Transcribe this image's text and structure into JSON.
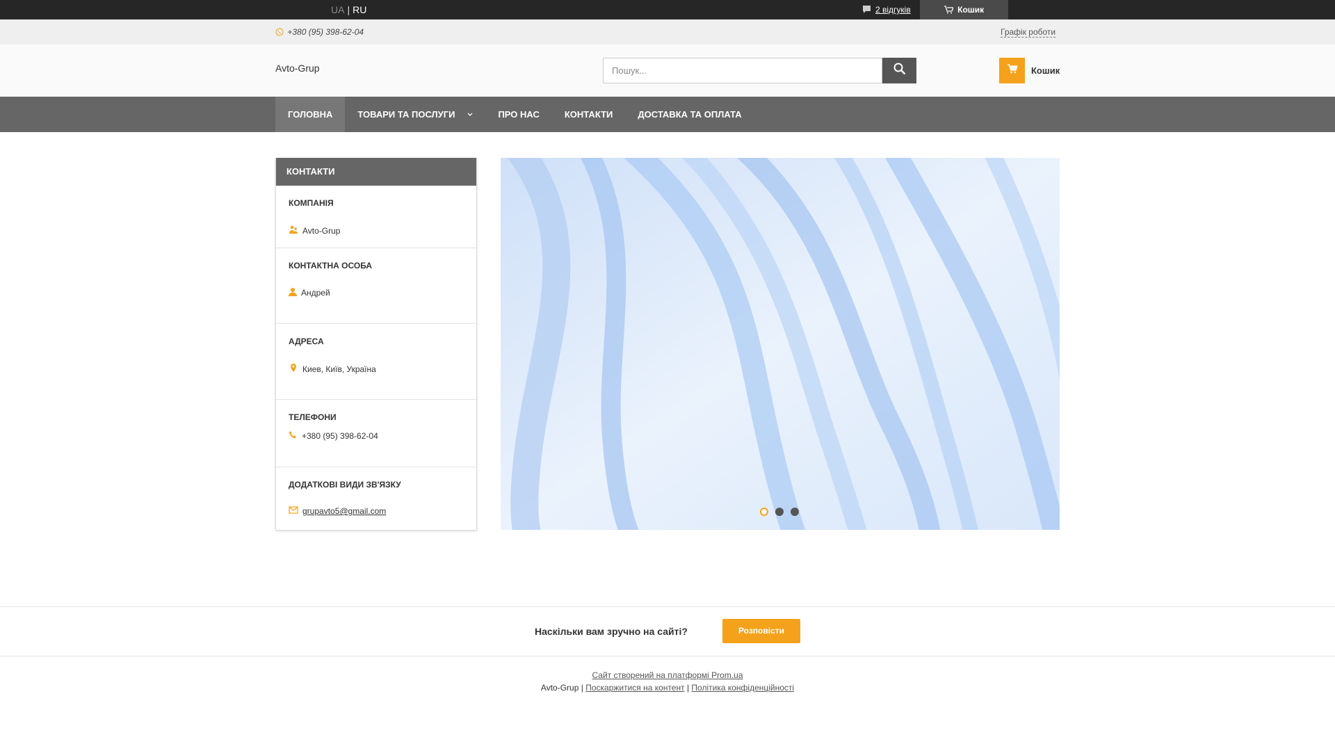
{
  "topbar": {
    "lang_ua": "UA",
    "lang_ru": "RU",
    "reviews": "2 відгуків",
    "cart": "Кошик"
  },
  "strip": {
    "phone": "+380 (95) 398-62-04",
    "schedule": "Графік роботи"
  },
  "header": {
    "logo": "Avto-Grup",
    "search_placeholder": "Пошук...",
    "cart_label": "Кошик"
  },
  "nav": {
    "items": [
      "ГОЛОВНА",
      "ТОВАРИ ТА ПОСЛУГИ",
      "ПРО НАС",
      "КОНТАКТИ",
      "ДОСТАВКА ТА ОПЛАТА"
    ]
  },
  "sidebar": {
    "title": "КОНТАКТИ",
    "company_title": "КОМПАНІЯ",
    "company": "Avto-Grup",
    "person_title": "КОНТАКТНА ОСОБА",
    "person": "Андрей",
    "address_title": "АДРЕСА",
    "address": "Киев, Київ, Україна",
    "phones_title": "ТЕЛЕФОНИ",
    "phone": "+380 (95) 398-62-04",
    "extra_title": "ДОДАТКОВІ ВИДИ ЗВ'ЯЗКУ",
    "email": "grupavto5@gmail.com"
  },
  "slider": {
    "slides": 3,
    "active": 1
  },
  "feedback": {
    "question": "Наскільки вам зручно на сайті?",
    "button": "Розповісти"
  },
  "footer": {
    "platform": "Сайт створений на платформі Prom.ua",
    "company": "Avto-Grup",
    "complain": "Поскаржитися на контент",
    "privacy": "Політика конфіденційності"
  },
  "colors": {
    "accent": "#f4a21c",
    "nav": "#666666",
    "topbar": "#262626"
  }
}
